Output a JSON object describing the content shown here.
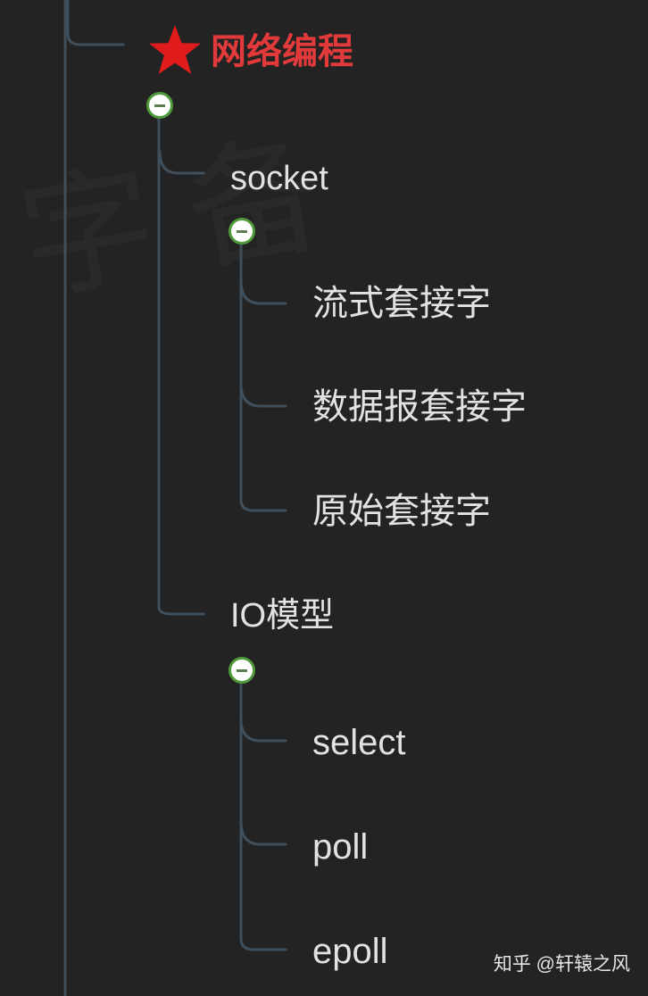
{
  "mindmap": {
    "root": {
      "label": "网络编程",
      "icon": "star-icon",
      "color": "#e23a3a"
    },
    "branches": [
      {
        "label": "socket",
        "children": [
          "流式套接字",
          "数据报套接字",
          "原始套接字"
        ]
      },
      {
        "label": "IO模型",
        "children": [
          "select",
          "poll",
          "epoll"
        ]
      }
    ],
    "collapse_icon": "collapse-minus-icon"
  },
  "watermark": "字备",
  "credit": "知乎 @轩辕之风",
  "colors": {
    "background": "#232323",
    "line": "#3f4f5c",
    "text": "#e2e2e2",
    "collapse_border": "#4f9a3a"
  }
}
